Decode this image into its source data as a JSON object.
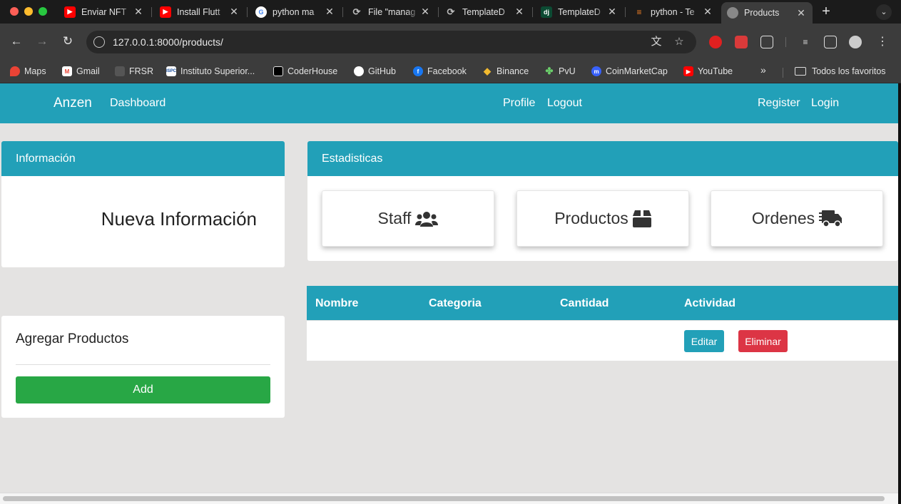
{
  "browser": {
    "tabs": [
      {
        "label": "Enviar NFT",
        "icon": "youtube-icon"
      },
      {
        "label": "Install Flutt",
        "icon": "youtube-icon"
      },
      {
        "label": "python ma",
        "icon": "google-icon"
      },
      {
        "label": "File \"manag",
        "icon": "github-copilot-icon"
      },
      {
        "label": "TemplateD",
        "icon": "github-copilot-icon"
      },
      {
        "label": "TemplateD",
        "icon": "django-icon"
      },
      {
        "label": "python - Te",
        "icon": "stackoverflow-icon"
      },
      {
        "label": "Products",
        "icon": "globe-icon",
        "active": true
      }
    ],
    "new_tab": "+",
    "url": "127.0.0.1:8000/products/",
    "bookmarks": [
      {
        "label": "Maps",
        "icon": "maps-icon"
      },
      {
        "label": "Gmail",
        "icon": "gmail-icon"
      },
      {
        "label": "FRSR",
        "icon": "frsr-icon"
      },
      {
        "label": "Instituto Superior...",
        "icon": "ispc-icon"
      },
      {
        "label": "CoderHouse",
        "icon": "coderhouse-icon"
      },
      {
        "label": "GitHub",
        "icon": "github-icon"
      },
      {
        "label": "Facebook",
        "icon": "facebook-icon"
      },
      {
        "label": "Binance",
        "icon": "binance-icon"
      },
      {
        "label": "PvU",
        "icon": "pvu-icon"
      },
      {
        "label": "CoinMarketCap",
        "icon": "coinmarketcap-icon"
      },
      {
        "label": "YouTube",
        "icon": "youtube-icon"
      }
    ],
    "bookmarks_more": "»",
    "all_bookmarks": "Todos los favoritos"
  },
  "navbar": {
    "brand": "Anzen",
    "dashboard": "Dashboard",
    "profile": "Profile",
    "logout": "Logout",
    "register": "Register",
    "login": "Login"
  },
  "info_card": {
    "header": "Información",
    "body": "Nueva Información"
  },
  "stats_card": {
    "header": "Estadisticas",
    "boxes": [
      {
        "label": "Staff",
        "icon": "users-icon"
      },
      {
        "label": "Productos",
        "icon": "box-icon"
      },
      {
        "label": "Ordenes",
        "icon": "truck-icon"
      }
    ]
  },
  "add_card": {
    "title": "Agregar Productos",
    "button": "Add"
  },
  "table": {
    "headers": [
      "Nombre",
      "Categoria",
      "Cantidad",
      "Actividad"
    ],
    "rows": [
      {
        "nombre": "",
        "categoria": "",
        "cantidad": "",
        "edit": "Editar",
        "delete": "Eliminar"
      }
    ]
  },
  "colors": {
    "accent": "#22a0b8",
    "success": "#28a745",
    "danger": "#dc3545",
    "page_bg": "#e4e3e2"
  }
}
